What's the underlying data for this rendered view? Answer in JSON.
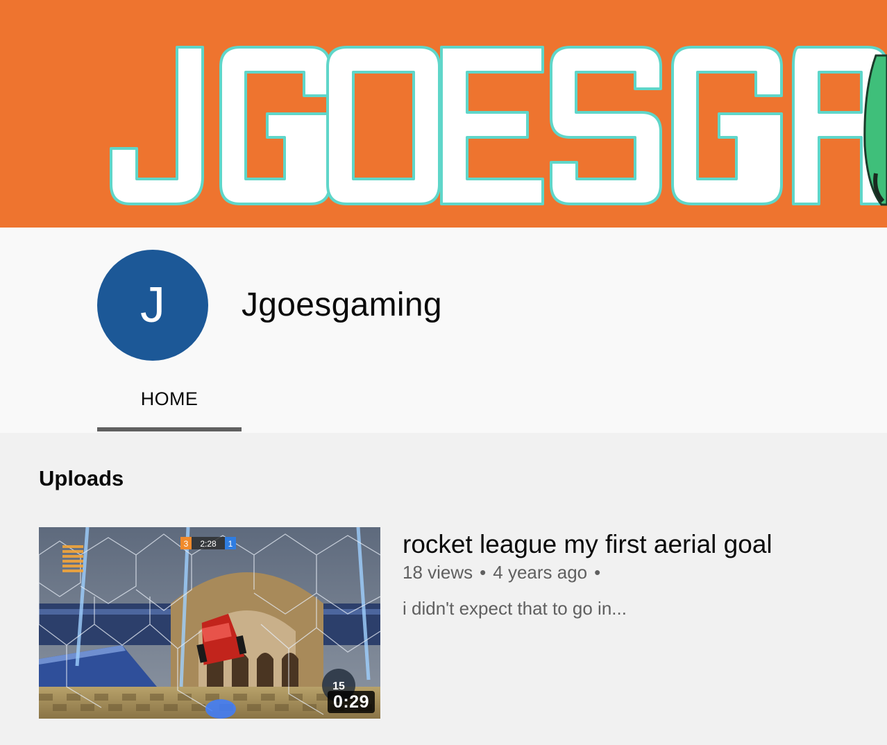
{
  "banner": {
    "text": "JGOESGA",
    "background": "#ee742f",
    "letter_fill": "#ffffff",
    "letter_outline": "#5fd6c9"
  },
  "channel": {
    "avatar_letter": "J",
    "avatar_color": "#1c5897",
    "name": "Jgoesgaming"
  },
  "tabs": [
    {
      "label": "HOME",
      "active": true
    }
  ],
  "uploads": {
    "section_title": "Uploads",
    "videos": [
      {
        "title": "rocket league my first aerial goal",
        "views": "18 views",
        "age": "4 years ago",
        "separator": "•",
        "description": "i didn't expect that to go in...",
        "duration": "0:29",
        "thumbnail_hud_time": "2:28",
        "thumbnail_hud_score_left": "3",
        "thumbnail_hud_score_right": "1",
        "thumbnail_boost": "15"
      }
    ]
  },
  "colors": {
    "page_bg": "#f1f1f1",
    "header_bg": "#f9f9f9",
    "meta_text": "#606060",
    "tab_underline": "#606060"
  }
}
